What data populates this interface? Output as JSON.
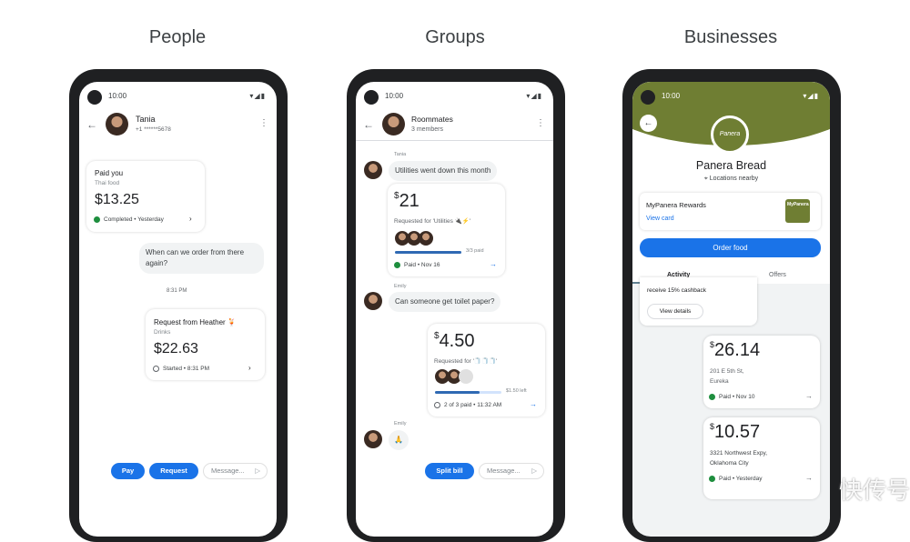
{
  "headings": [
    "People",
    "Groups",
    "Businesses"
  ],
  "status_time": "10:00",
  "colors": {
    "accent": "#1a73e8",
    "panera_green": "#6f7e33",
    "bubble": "#f1f3f4",
    "paid_green": "#1e8e3e"
  },
  "people": {
    "contact_name": "Tania",
    "contact_phone": "+1 ******5678",
    "payment": {
      "title": "Paid you",
      "note": "Thai food",
      "amount": "$13.25",
      "status": "Completed • Yesterday"
    },
    "message": "When can we order from there again?",
    "timestamp": "8:31 PM",
    "request": {
      "title": "Request from Heather 🍹",
      "note": "Drinks",
      "amount": "$22.63",
      "status": "Started • 8:31 PM"
    },
    "pay_label": "Pay",
    "request_label": "Request",
    "message_placeholder": "Message..."
  },
  "groups": {
    "group_name": "Roommates",
    "members": "3 members",
    "sender1": "Tania",
    "message1": "Utilities went down this month",
    "bill1": {
      "currency": "$",
      "amount": "21",
      "note": "Requested for 'Utilities 🔌⚡'",
      "progress_label": "3/3 paid",
      "progress": 1.0,
      "status": "Paid • Nov 16"
    },
    "sender2": "Emily",
    "message2": "Can someone get toilet paper?",
    "bill2": {
      "currency": "$",
      "amount": "4.50",
      "note": "Requested for '🧻🧻🧻'",
      "progress_label": "$1.50 left",
      "progress": 0.67,
      "status": "2 of 3 paid • 11:32 AM"
    },
    "sender3": "Emily",
    "message3": "🙏",
    "split_label": "Split bill",
    "message_placeholder": "Message..."
  },
  "business": {
    "logo_text": "Panera",
    "name": "Panera Bread",
    "location": "Locations nearby",
    "rewards_title": "MyPanera Rewards",
    "rewards_link": "View card",
    "card_text": "MyPanera",
    "order_label": "Order food",
    "tabs": [
      "Activity",
      "Offers"
    ],
    "active_tab": "Activity",
    "offer_text": "receive 15% cashback",
    "offer_button": "View details",
    "transactions": [
      {
        "currency": "$",
        "amount": "26.14",
        "address1": "201 E 5th St,",
        "address2": "Eureka",
        "status": "Paid • Nov 10"
      },
      {
        "currency": "$",
        "amount": "10.57",
        "address1": "3321 Northwest Expy,",
        "address2": "Oklahoma City",
        "status": "Paid • Yesterday"
      }
    ]
  },
  "watermark": "快传号"
}
